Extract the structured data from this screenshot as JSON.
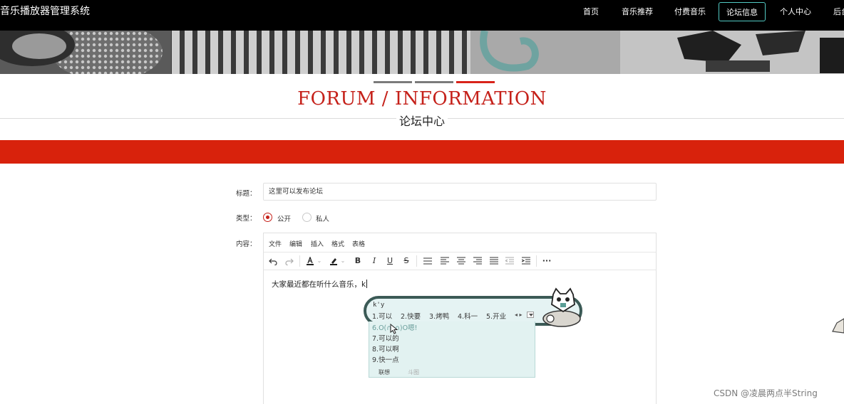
{
  "app": {
    "title": "音乐播放器管理系统"
  },
  "nav": {
    "items": [
      {
        "label": "首页",
        "active": false
      },
      {
        "label": "音乐推荐",
        "active": false
      },
      {
        "label": "付费音乐",
        "active": false
      },
      {
        "label": "论坛信息",
        "active": true
      },
      {
        "label": "个人中心",
        "active": false
      },
      {
        "label": "后台",
        "active": false
      }
    ]
  },
  "section": {
    "title_en": "FORUM / INFORMATION",
    "title_cn": "论坛中心"
  },
  "form": {
    "title_label": "标题：",
    "title_value": "这里可以发布论坛",
    "type_label": "类型：",
    "type_options": [
      {
        "label": "公开",
        "selected": true
      },
      {
        "label": "私人",
        "selected": false
      }
    ],
    "content_label": "内容："
  },
  "editor": {
    "menus": [
      "文件",
      "编辑",
      "插入",
      "格式",
      "表格"
    ],
    "content": "大家最近都在听什么音乐，k",
    "toolbar_icons": [
      "undo-icon",
      "redo-icon",
      "font-color-icon",
      "highlight-icon",
      "bold-icon",
      "italic-icon",
      "underline-icon",
      "strikethrough-icon",
      "list-icon",
      "align-left-icon",
      "align-center-icon",
      "align-right-icon",
      "align-justify-icon",
      "outdent-icon",
      "indent-icon",
      "more-icon"
    ]
  },
  "ime": {
    "input": "k'y",
    "candidates_row": [
      "1.可以",
      "2.快要",
      "3.烤鸭",
      "4.科一",
      "5.开业"
    ],
    "candidates_list": [
      "6.O(∩_∩)O嗯!",
      "7.可以的",
      "8.可以啊",
      "9.快一点"
    ],
    "tabs": [
      "联想",
      "斗图"
    ]
  },
  "watermark": "CSDN @凌晨两点半String",
  "colors": {
    "accent_red": "#d8220c",
    "nav_active_border": "#52c9c3",
    "topbar": "#000000"
  }
}
